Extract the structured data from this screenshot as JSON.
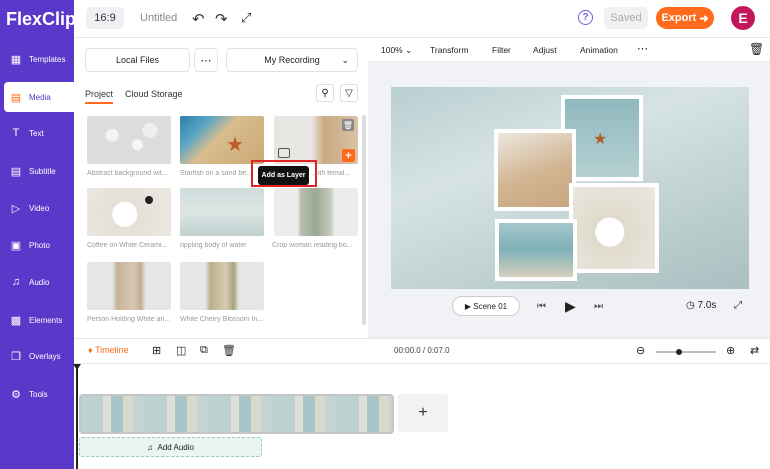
{
  "app": {
    "logo": "FlexClip",
    "ratio": "16:9",
    "title": "Untitled",
    "saved": "Saved",
    "export": "Export",
    "avatar_letter": "E"
  },
  "sidebar": {
    "items": [
      {
        "label": "Templates",
        "icon": "templates-icon"
      },
      {
        "label": "Media",
        "icon": "media-icon"
      },
      {
        "label": "Text",
        "icon": "text-icon"
      },
      {
        "label": "Subtitle",
        "icon": "subtitle-icon"
      },
      {
        "label": "Video",
        "icon": "video-icon"
      },
      {
        "label": "Photo",
        "icon": "photo-icon"
      },
      {
        "label": "Audio",
        "icon": "audio-icon"
      },
      {
        "label": "Elements",
        "icon": "elements-icon"
      },
      {
        "label": "Overlays",
        "icon": "overlays-icon"
      },
      {
        "label": "Tools",
        "icon": "tools-icon"
      }
    ],
    "active": "Media"
  },
  "media": {
    "local_files": "Local Files",
    "recording": "My Recording",
    "tabs": [
      "Project",
      "Cloud Storage"
    ],
    "items": [
      {
        "caption": "Abstract background wit..."
      },
      {
        "caption": "Starfish on a sand be..."
      },
      {
        "caption": "...ith femal..."
      },
      {
        "caption": "Coffee on White Cerami..."
      },
      {
        "caption": "rippling body of water"
      },
      {
        "caption": "Crop woman reading bo..."
      },
      {
        "caption": "Person Holding White an..."
      },
      {
        "caption": "White Cherry Blossom In..."
      }
    ],
    "tooltip": "Add as Layer"
  },
  "preview_toolbar": {
    "zoom": "100%",
    "transform": "Transform",
    "filter": "Filter",
    "adjust": "Adjust",
    "animation": "Animation"
  },
  "player": {
    "scene": "Scene",
    "scene_num": "01",
    "duration": "7.0s"
  },
  "timeline": {
    "label": "Timeline",
    "time": "00:00.0 / 0:07.0",
    "clip_index": "01",
    "add_audio": "Add Audio"
  },
  "colors": {
    "sidebar": "#5a38c9",
    "accent": "#ff6b1a",
    "avatar": "#c2185b"
  }
}
